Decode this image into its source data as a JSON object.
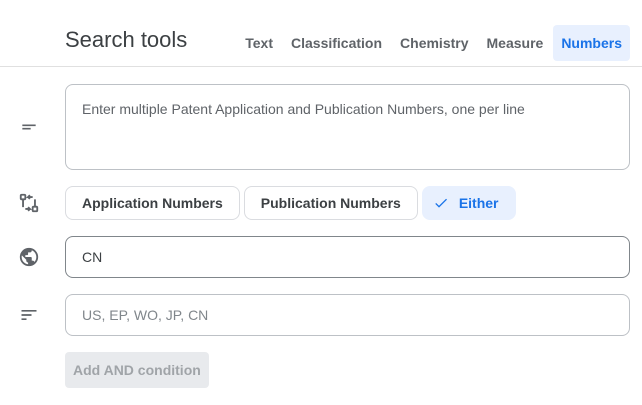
{
  "header": {
    "title": "Search tools",
    "tabs": [
      {
        "label": "Text",
        "active": false
      },
      {
        "label": "Classification",
        "active": false
      },
      {
        "label": "Chemistry",
        "active": false
      },
      {
        "label": "Measure",
        "active": false
      },
      {
        "label": "Numbers",
        "active": true
      }
    ]
  },
  "numbers_input": {
    "value": "",
    "placeholder": "Enter multiple Patent Application and Publication Numbers, one per line"
  },
  "number_type": {
    "options": [
      "Application Numbers",
      "Publication Numbers",
      "Either"
    ],
    "selected": "Either"
  },
  "country_field": {
    "value": "CN",
    "placeholder": ""
  },
  "priority_field": {
    "value": "",
    "placeholder": "US, EP, WO, JP, CN"
  },
  "add_condition": {
    "label": "Add AND condition",
    "disabled": true
  },
  "icons": {
    "row1": "short-text-icon",
    "row2": "route-icon",
    "row3": "globe-icon",
    "row4": "sort-icon",
    "check": "check-icon"
  },
  "colors": {
    "accent": "#1a73e8",
    "accent_bg": "#e8f0fe",
    "text": "#3c4043",
    "icon": "#5f6368"
  }
}
